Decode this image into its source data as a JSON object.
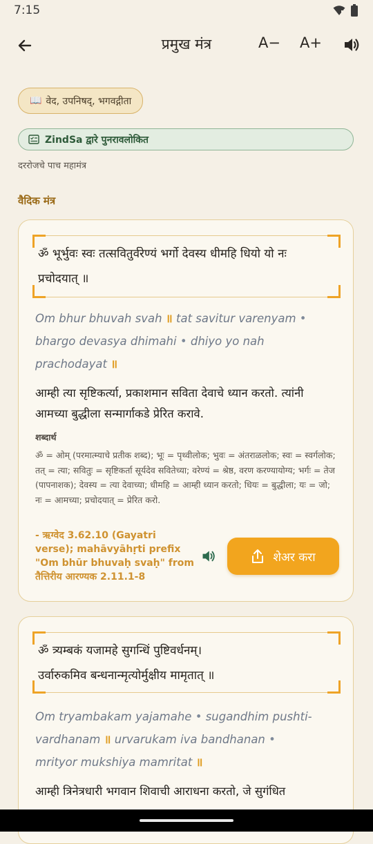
{
  "status_bar": {
    "time": "7:15",
    "wifi_icon": "wifi-icon",
    "battery_icon": "battery-icon"
  },
  "app_bar": {
    "title": "प्रमुख मंत्र",
    "font_decrease": "A−",
    "font_increase": "A+",
    "back_icon": "arrow-back-icon",
    "speaker_icon": "speaker-icon"
  },
  "source_chip": {
    "icon": "📖",
    "label": "वेद, उपनिषद्, भगवद्गीता"
  },
  "review_chip": {
    "label": "ZindSa द्वारे पुनरावलोकित"
  },
  "subtitle": "दररोजचे पाच महामंत्र",
  "section_title": "वैदिक मंत्र",
  "mantras": [
    {
      "sanskrit_lines": [
        "ॐ भूर्भुवः स्वः तत्सवितुर्वरेण्यं भर्गो देवस्य धीमहि धियो यो नः",
        "प्रचोदयात् ॥"
      ],
      "translit": {
        "l1a": "Om bhur bhuvah svah",
        "l1b": "tat savitur varenyam",
        "l2a": "bhargo devasya dhimahi",
        "l2b": "dhiyo yo nah",
        "l3a": "prachodayat"
      },
      "meaning": "आम्ही त्या सृष्टिकर्त्या, प्रकाशमान सविता देवाचे ध्यान करतो. त्यांनी आमच्या बुद्धीला सन्मार्गाकडे प्रेरित करावे.",
      "word_meaning_label": "शब्दार्थ",
      "word_meaning": "ॐ = ओम् (परमात्म्याचे प्रतीक शब्द); भूः = पृथ्वीलोक; भुवः = अंतराळलोक; स्वः = स्वर्गलोक; तत् = त्या; सवितुः = सृष्टिकर्ता सूर्यदेव सवितेच्या; वरेण्यं = श्रेष्ठ, वरण करण्यायोग्य; भर्गः = तेज (पापनाशक); देवस्य = त्या देवाच्या; धीमहि = आम्ही ध्यान करतो; धियः = बुद्धीला; यः = जो; नः = आमच्या; प्रचोदयात् = प्रेरित करो.",
      "source": "- ऋग्वेद 3.62.10 (Gayatri verse); mahāvyāhṛti prefix \"Om bhūr bhuvaḥ svaḥ\" from तैत्तिरीय आरण्यक 2.11.1-8",
      "share_label": "शेअर करा"
    },
    {
      "sanskrit_lines": [
        "ॐ त्र्यम्बकं यजामहे सुगन्धिं पुष्टिवर्धनम्।",
        "उर्वारुकमिव बन्धनान्मृत्योर्मुक्षीय मामृतात् ॥"
      ],
      "translit": {
        "l1a": "Om tryambakam yajamahe",
        "l1b": "sugandhim pushti-",
        "l2a": "vardhanam",
        "l2b": "urvarukam iva bandhanan",
        "l3a": "mrityor mukshiya mamritat"
      },
      "meaning": "आम्ही त्रिनेत्रधारी भगवान शिवाची आराधना करतो, जे सुगंधित"
    }
  ]
}
